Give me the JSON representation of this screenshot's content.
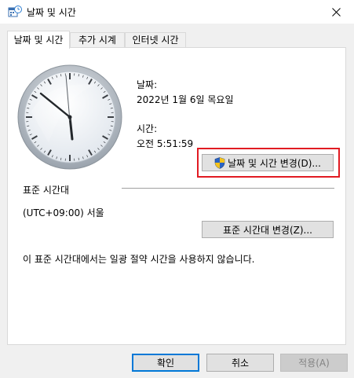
{
  "window": {
    "title": "날짜 및 시간",
    "icon": "date-time-icon",
    "close_icon": "close-icon"
  },
  "tabs": [
    {
      "label": "날짜 및 시간",
      "active": true
    },
    {
      "label": "추가 시계",
      "active": false
    },
    {
      "label": "인터넷 시간",
      "active": false
    }
  ],
  "datetime": {
    "date_label": "날짜:",
    "date_value": "2022년 1월 6일 목요일",
    "time_label": "시간:",
    "time_value": "오전 5:51:59",
    "change_button": "날짜 및 시간 변경(D)..."
  },
  "timezone": {
    "section_label": "표준 시간대",
    "value": "(UTC+09:00) 서울",
    "change_button": "표준 시간대 변경(Z)...",
    "dst_note": "이 표준 시간대에서는 일광 절약 시간을 사용하지 않습니다."
  },
  "footer": {
    "ok": "확인",
    "cancel": "취소",
    "apply": "적용(A)"
  },
  "colors": {
    "highlight": "#e11b22",
    "accent": "#0078d7"
  }
}
